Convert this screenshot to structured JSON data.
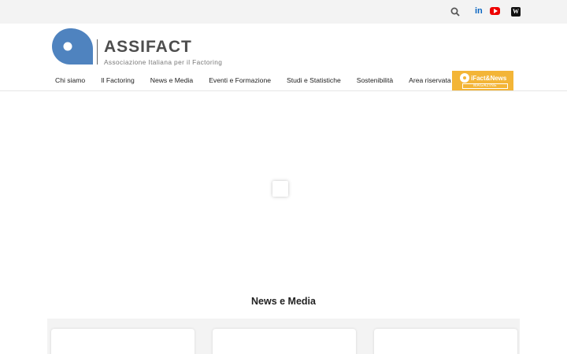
{
  "brand": {
    "name": "ASSIFACT",
    "tagline": "Associazione Italiana per il Factoring",
    "color": "#4f83bf"
  },
  "topbar": {
    "icons": [
      "search-icon",
      "linkedin-icon",
      "youtube-icon",
      "wikipedia-icon"
    ],
    "linkedin_label": "in",
    "wiki_label": "W"
  },
  "nav": {
    "items": [
      {
        "label": "Chi siamo"
      },
      {
        "label": "Il Factoring"
      },
      {
        "label": "News e Media"
      },
      {
        "label": "Eventi e Formazione"
      },
      {
        "label": "Studi e Statistiche"
      },
      {
        "label": "Sostenibilità"
      },
      {
        "label": "Area riservata"
      }
    ]
  },
  "magazine": {
    "title": "iFact&News",
    "subtitle": "MAGAZINE",
    "color": "#f3b537"
  },
  "news": {
    "title": "News e Media"
  }
}
